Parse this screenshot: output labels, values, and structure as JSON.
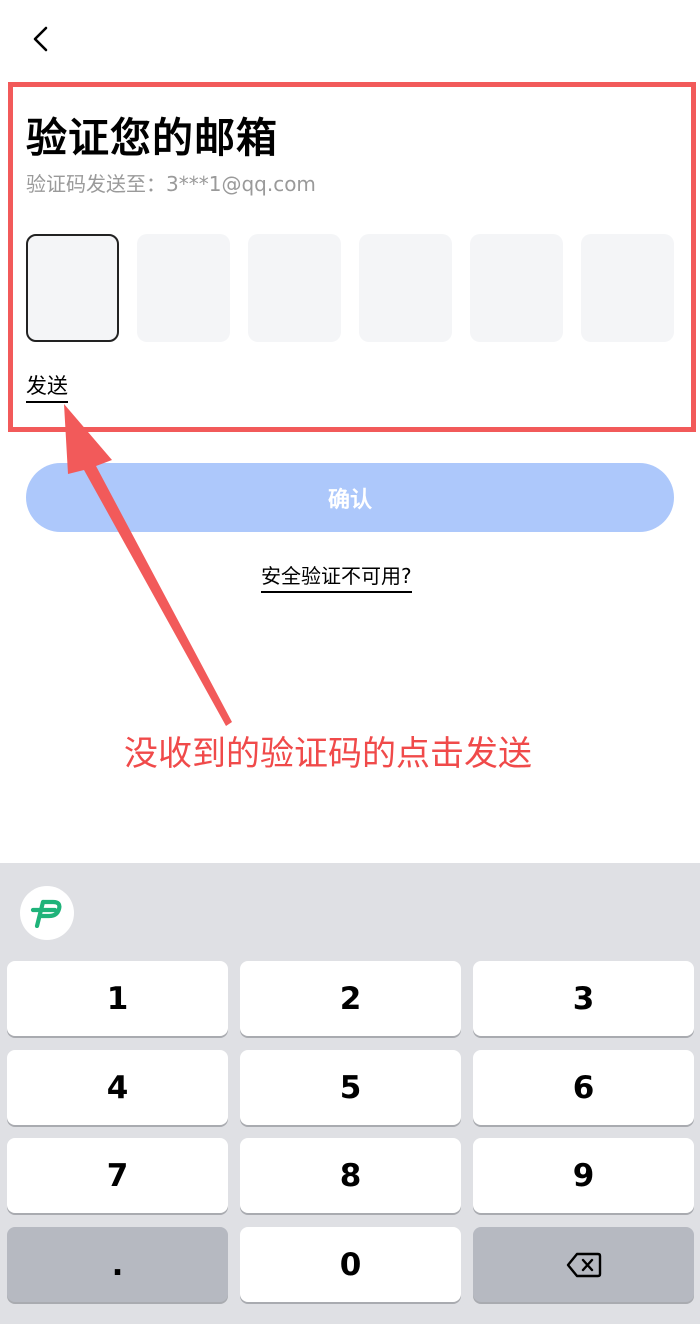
{
  "header": {
    "back_icon": "chevron-left-icon"
  },
  "verify": {
    "title": "验证您的邮箱",
    "subtitle": "验证码发送至：3***1@qq.com",
    "code_length": 6,
    "send_label": "发送"
  },
  "confirm_label": "确认",
  "unavailable_label": "安全验证不可用?",
  "annotation": {
    "text": "没收到的验证码的点击发送",
    "color": "#f04a4a"
  },
  "keyboard": {
    "logo_icon": "pinyin-p-logo-icon",
    "keys": {
      "k1": "1",
      "k2": "2",
      "k3": "3",
      "k4": "4",
      "k5": "5",
      "k6": "6",
      "k7": "7",
      "k8": "8",
      "k9": "9",
      "dot": ".",
      "k0": "0"
    },
    "backspace_icon": "backspace-icon"
  },
  "colors": {
    "accent_disabled": "#adc8fb",
    "highlight": "#f25a5a",
    "logo": "#1fb37a"
  }
}
